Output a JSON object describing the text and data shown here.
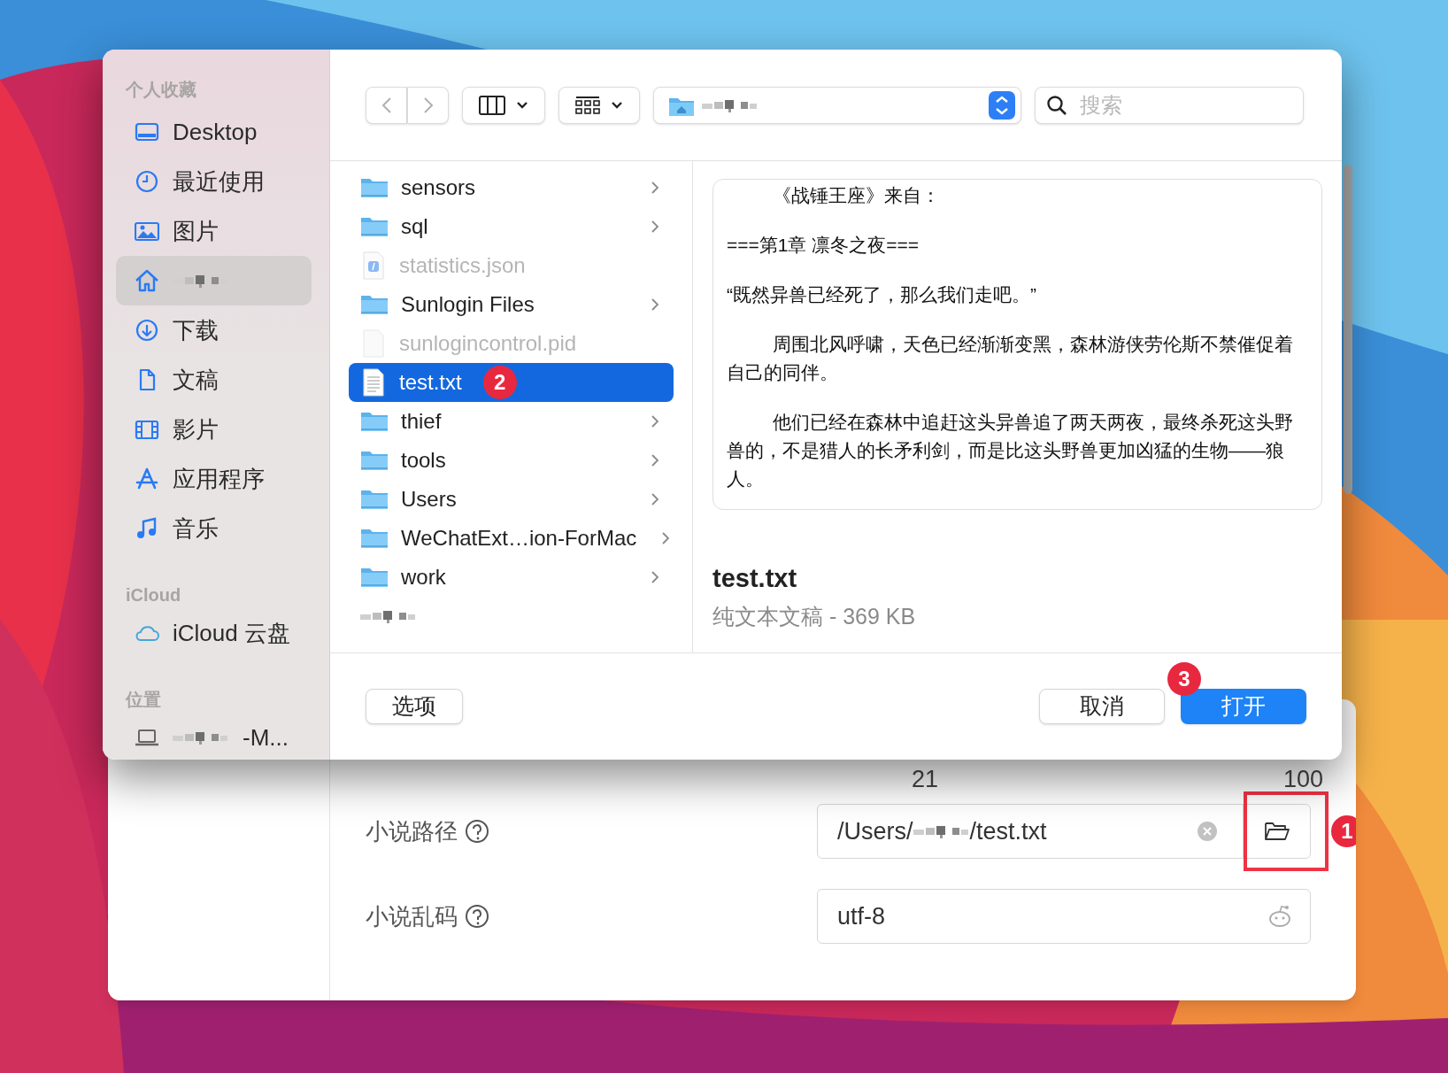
{
  "sidebar": {
    "sections": [
      {
        "title": "个人收藏",
        "items": [
          {
            "kind": "desktop",
            "label": "Desktop",
            "selected": false
          },
          {
            "kind": "clock",
            "label": "最近使用",
            "selected": false
          },
          {
            "label": "图片",
            "selected": false
          },
          {
            "kind": "home",
            "masked": true,
            "selected": true
          },
          {
            "kind": "download",
            "label": "下载",
            "selected": false
          },
          {
            "kind": "document",
            "label": "文稿",
            "selected": false
          },
          {
            "kind": "film",
            "label": "影片",
            "selected": false
          },
          {
            "kind": "apps",
            "label": "应用程序",
            "selected": false
          },
          {
            "kind": "music",
            "label": "音乐",
            "selected": false
          }
        ]
      },
      {
        "title": "iCloud",
        "items": [
          {
            "kind": "cloud",
            "label": "iCloud 云盘",
            "selected": false
          }
        ]
      },
      {
        "title": "位置",
        "items": [
          {
            "kind": "laptop",
            "masked": true,
            "label": "-M...",
            "selected": false
          }
        ]
      }
    ]
  },
  "toolbar": {
    "location": {
      "masked": true
    },
    "search": {
      "placeholder": "搜索"
    }
  },
  "files": [
    {
      "kind": "folder",
      "name": "sensors",
      "disabled": false,
      "selected": false
    },
    {
      "kind": "folder",
      "name": "sql",
      "disabled": false,
      "selected": false
    },
    {
      "kind": "json",
      "name": "statistics.json",
      "disabled": true,
      "selected": false
    },
    {
      "kind": "folder",
      "name": "Sunlogin Files",
      "disabled": false,
      "selected": false
    },
    {
      "kind": "blank",
      "name": "sunlogincontrol.pid",
      "disabled": true,
      "selected": false
    },
    {
      "kind": "text",
      "name": "test.txt",
      "disabled": false,
      "selected": true,
      "badge": "2"
    },
    {
      "kind": "folder",
      "name": "thief",
      "disabled": false,
      "selected": false
    },
    {
      "kind": "folder",
      "name": "tools",
      "disabled": false,
      "selected": false
    },
    {
      "kind": "folder",
      "name": "Users",
      "disabled": false,
      "selected": false
    },
    {
      "kind": "folder",
      "name": "WeChatExt…ion-ForMac",
      "disabled": false,
      "selected": false
    },
    {
      "kind": "folder",
      "name": "work",
      "disabled": false,
      "selected": false
    },
    {
      "kind": "masked",
      "selected": false
    }
  ],
  "preview": {
    "paragraphs": [
      {
        "text": "《战锤王座》来自：",
        "indent": true
      },
      {
        "text": "===第1章  凛冬之夜===",
        "indent": false
      },
      {
        "text": "“既然异兽已经死了，那么我们走吧。”",
        "indent": false
      },
      {
        "text": "周围北风呼啸，天色已经渐渐变黑，森林游侠劳伦斯不禁催促着自己的同伴。",
        "indent": true
      },
      {
        "text": "他们已经在森林中追赶这头异兽追了两天两夜，最终杀死这头野兽的，不是猎人的长矛利剑，而是比这头野兽更加凶猛的生物——狼人。",
        "indent": true
      }
    ],
    "name": "test.txt",
    "meta": "纯文本文稿 - 369 KB"
  },
  "left_buttons": [
    {
      "label": "选项",
      "kind": "secondary"
    }
  ],
  "right_buttons": [
    {
      "label": "取消",
      "kind": "secondary"
    },
    {
      "label": "打开",
      "kind": "primary",
      "badge": "3"
    }
  ],
  "form": {
    "scale": [
      "21",
      "100"
    ],
    "rows": [
      {
        "kind": "path",
        "label": "小说路径",
        "value_start": "/Users/",
        "masked": true,
        "value_end": "/test.txt",
        "badge": "1",
        "highlighted": true
      },
      {
        "kind": "encoding",
        "label": "小说乱码",
        "value_start": "utf-8",
        "highlighted": false
      }
    ]
  }
}
